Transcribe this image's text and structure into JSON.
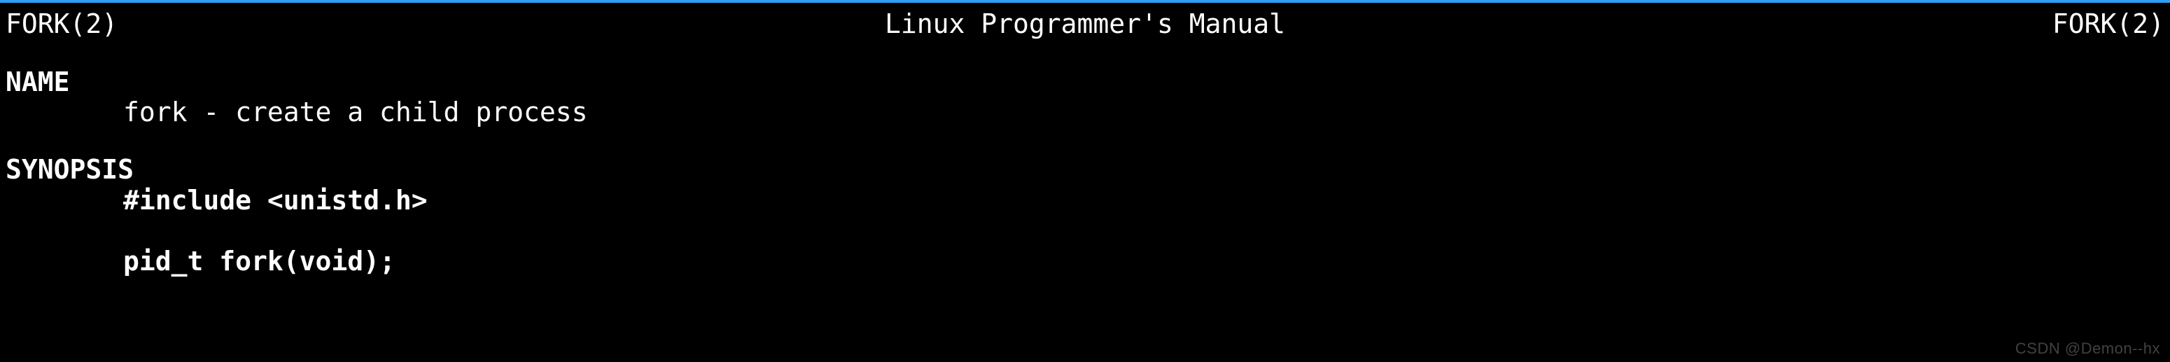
{
  "header": {
    "left": "FORK(2)",
    "center": "Linux Programmer's Manual",
    "right": "FORK(2)"
  },
  "sections": {
    "name": {
      "heading": "NAME",
      "body": "fork - create a child process"
    },
    "synopsis": {
      "heading": "SYNOPSIS",
      "include": "#include <unistd.h>",
      "prototype": "pid_t fork(void);"
    }
  },
  "watermark": "CSDN @Demon--hx"
}
